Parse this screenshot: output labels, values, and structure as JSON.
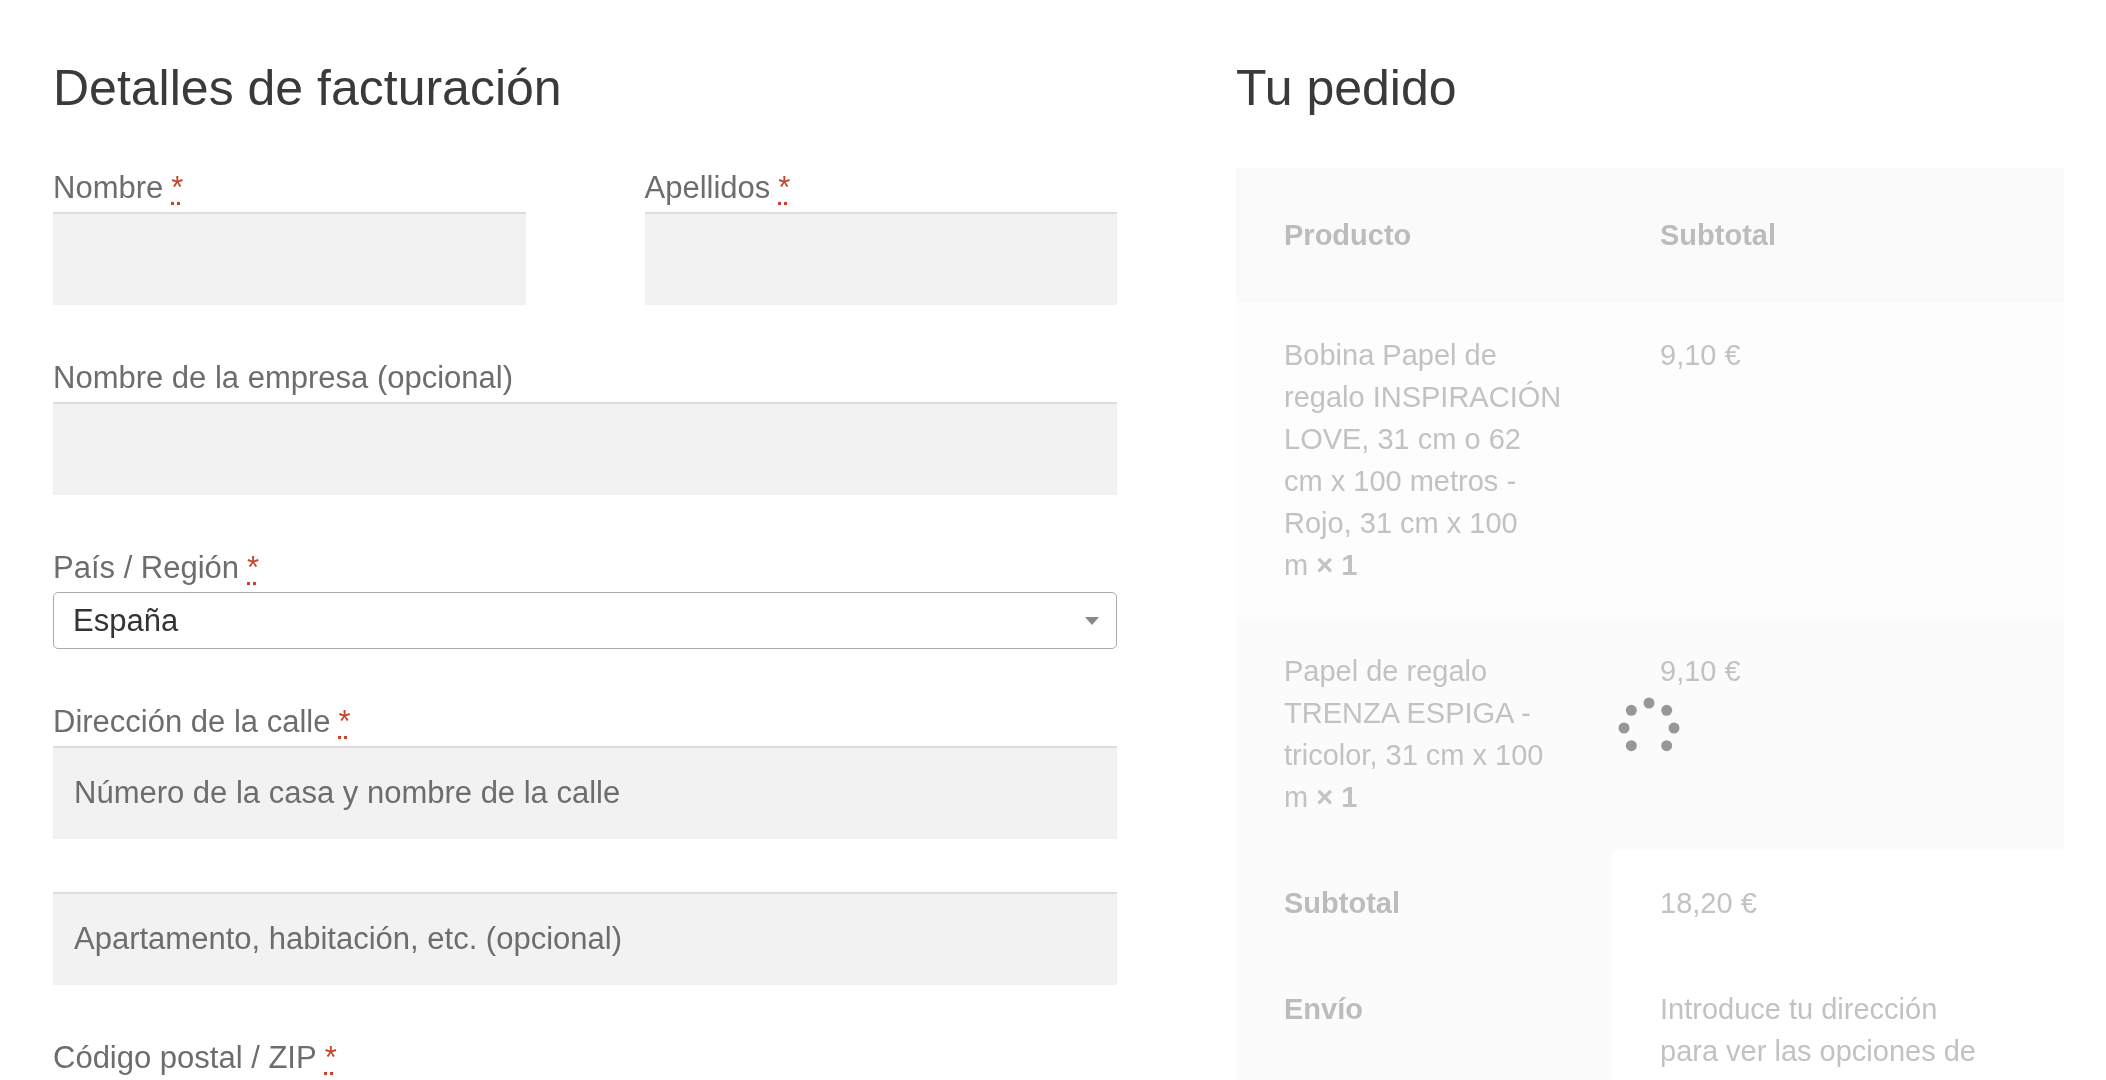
{
  "billing": {
    "title": "Detalles de facturación",
    "rows": [
      {
        "fields": [
          {
            "kind": "text",
            "label": "Nombre",
            "required_mark": "*"
          },
          {
            "kind": "text",
            "label": "Apellidos",
            "required_mark": "*"
          }
        ]
      },
      {
        "fields": [
          {
            "kind": "text",
            "label": "Nombre de la empresa (opcional)"
          }
        ]
      },
      {
        "fields": [
          {
            "kind": "select",
            "label": "País / Región",
            "required_mark": "*",
            "value": "España"
          }
        ]
      },
      {
        "fields": [
          {
            "kind": "text",
            "label": "Dirección de la calle",
            "required_mark": "*",
            "placeholder": "Número de la casa y nombre de la calle"
          }
        ]
      },
      {
        "fields": [
          {
            "kind": "text",
            "placeholder": "Apartamento, habitación, etc. (opcional)"
          }
        ]
      },
      {
        "fields": [
          {
            "kind": "label_only",
            "label": "Código postal / ZIP",
            "required_mark": "*"
          }
        ]
      }
    ]
  },
  "order": {
    "title": "Tu pedido",
    "loading": true,
    "columns": [
      "Producto",
      "Subtotal"
    ],
    "items": [
      {
        "name": "Bobina Papel de regalo INSPIRACIÓN LOVE, 31 cm o 62 cm x 100 metros - Rojo, 31 cm x 100 m",
        "quantity": "× 1",
        "subtotal": "9,10 €"
      },
      {
        "name": "Papel de regalo TRENZA ESPIGA - tricolor, 31 cm x 100 m",
        "quantity": "× 1",
        "subtotal": "9,10 €"
      }
    ],
    "totals": [
      {
        "label": "Subtotal",
        "value": "18,20 €"
      },
      {
        "label": "Envío",
        "value": "Introduce tu dirección para ver las opciones de"
      }
    ]
  }
}
